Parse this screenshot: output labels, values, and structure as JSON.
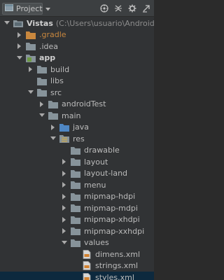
{
  "header": {
    "project_label": "Project",
    "icons": [
      "project-icon",
      "dropdown-icon",
      "sync-icon",
      "collapse-icon",
      "gear-icon",
      "hide-icon"
    ]
  },
  "colors": {
    "background": "#313335",
    "folder": "#87939a",
    "module_folder": "#6d9a42",
    "source_folder": "#4f87c4",
    "res_folder": "#c9a64d",
    "selected": "#0d293e"
  },
  "tree": {
    "root_name": "Vistas",
    "root_path": "(C:\\Users\\usuario\\AndroidStudioPr",
    "items": [
      {
        "label": ".gradle",
        "style": "orange"
      },
      {
        "label": ".idea",
        "style": "normal"
      },
      {
        "label": "app",
        "style": "bold"
      },
      {
        "label": "build",
        "style": "normal"
      },
      {
        "label": "libs",
        "style": "normal"
      },
      {
        "label": "src",
        "style": "normal"
      },
      {
        "label": "androidTest",
        "style": "normal"
      },
      {
        "label": "main",
        "style": "normal"
      },
      {
        "label": "java",
        "style": "normal"
      },
      {
        "label": "res",
        "style": "normal"
      },
      {
        "label": "drawable",
        "style": "normal"
      },
      {
        "label": "layout",
        "style": "normal"
      },
      {
        "label": "layout-land",
        "style": "normal"
      },
      {
        "label": "menu",
        "style": "normal"
      },
      {
        "label": "mipmap-hdpi",
        "style": "normal"
      },
      {
        "label": "mipmap-mdpi",
        "style": "normal"
      },
      {
        "label": "mipmap-xhdpi",
        "style": "normal"
      },
      {
        "label": "mipmap-xxhdpi",
        "style": "normal"
      },
      {
        "label": "values",
        "style": "normal"
      },
      {
        "label": "dimens.xml",
        "style": "normal"
      },
      {
        "label": "strings.xml",
        "style": "normal"
      },
      {
        "label": "styles.xml",
        "style": "normal",
        "selected": true
      }
    ]
  }
}
